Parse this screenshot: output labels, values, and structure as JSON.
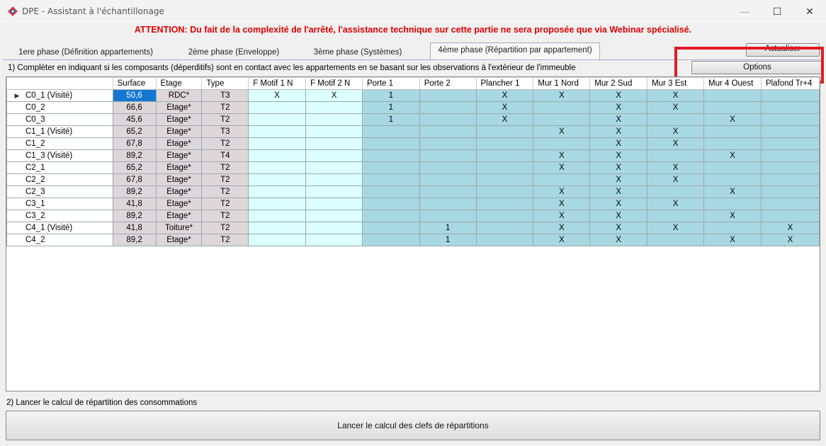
{
  "window": {
    "title": "DPE - Assistant à l'échantillonage",
    "min_glyph": "—",
    "max_glyph": "☐",
    "close_glyph": "✕",
    "icon": "app-logo-icon"
  },
  "attention": "ATTENTION: Du fait de la complexité de l'arrêté, l'assistance technique sur cette partie ne sera proposée que via Webinar spécialisé.",
  "tabs": [
    {
      "label": "1ere phase (Définition appartements)",
      "active": false
    },
    {
      "label": "2ème phase (Enveloppe)",
      "active": false
    },
    {
      "label": "3ème phase (Systèmes)",
      "active": false
    },
    {
      "label": "4ème phase (Répartition par appartement)",
      "active": true
    }
  ],
  "buttons": {
    "actualiser": "Actualiser",
    "options": "Options",
    "calc": "Lancer le calcul des clefs de répartitions"
  },
  "instructions": {
    "step1": "1) Compléter en indiquant si les composants (déperditifs) sont en contact avec les appartements en se basant sur les observations à l'extérieur de l'immeuble",
    "step2": "2) Lancer le calcul de répartition des consommations"
  },
  "grid": {
    "columns": [
      "Surface",
      "Etage",
      "Type",
      "F Motif 1 N",
      "F Motif 2 N",
      "Porte  1",
      "Porte  2",
      "Plancher  1",
      "Mur  1 Nord",
      "Mur  2 Sud",
      "Mur  3 Est",
      "Mur  4 Ouest",
      "Plafond Tr+4"
    ],
    "rows": [
      {
        "name": "C0_1 (Visité)",
        "cells": [
          "50,6",
          "RDC*",
          "T3",
          "X",
          "X",
          "1",
          "",
          "X",
          "X",
          "X",
          "X",
          "",
          ""
        ]
      },
      {
        "name": "C0_2",
        "cells": [
          "66,6",
          "Etage*",
          "T2",
          "",
          "",
          "1",
          "",
          "X",
          "",
          "X",
          "X",
          "",
          ""
        ]
      },
      {
        "name": "C0_3",
        "cells": [
          "45,6",
          "Etage*",
          "T2",
          "",
          "",
          "1",
          "",
          "X",
          "",
          "X",
          "",
          "X",
          ""
        ]
      },
      {
        "name": "C1_1 (Visité)",
        "cells": [
          "65,2",
          "Etage*",
          "T3",
          "",
          "",
          "",
          "",
          "",
          "X",
          "X",
          "X",
          "",
          ""
        ]
      },
      {
        "name": "C1_2",
        "cells": [
          "67,8",
          "Etage*",
          "T2",
          "",
          "",
          "",
          "",
          "",
          "",
          "X",
          "X",
          "",
          ""
        ]
      },
      {
        "name": "C1_3 (Visité)",
        "cells": [
          "89,2",
          "Etage*",
          "T4",
          "",
          "",
          "",
          "",
          "",
          "X",
          "X",
          "",
          "X",
          ""
        ]
      },
      {
        "name": "C2_1",
        "cells": [
          "65,2",
          "Etage*",
          "T2",
          "",
          "",
          "",
          "",
          "",
          "X",
          "X",
          "X",
          "",
          ""
        ]
      },
      {
        "name": "C2_2",
        "cells": [
          "67,8",
          "Etage*",
          "T2",
          "",
          "",
          "",
          "",
          "",
          "",
          "X",
          "X",
          "",
          ""
        ]
      },
      {
        "name": "C2_3",
        "cells": [
          "89,2",
          "Etage*",
          "T2",
          "",
          "",
          "",
          "",
          "",
          "X",
          "X",
          "",
          "X",
          ""
        ]
      },
      {
        "name": "C3_1",
        "cells": [
          "41,8",
          "Etage*",
          "T2",
          "",
          "",
          "",
          "",
          "",
          "X",
          "X",
          "X",
          "",
          ""
        ]
      },
      {
        "name": "C3_2",
        "cells": [
          "89,2",
          "Etage*",
          "T2",
          "",
          "",
          "",
          "",
          "",
          "X",
          "X",
          "",
          "X",
          ""
        ]
      },
      {
        "name": "C4_1 (Visité)",
        "cells": [
          "41,8",
          "Toiture*",
          "T2",
          "",
          "",
          "",
          "1",
          "",
          "X",
          "X",
          "X",
          "",
          "X"
        ]
      },
      {
        "name": "C4_2",
        "cells": [
          "89,2",
          "Etage*",
          "T2",
          "",
          "",
          "",
          "1",
          "",
          "X",
          "X",
          "",
          "X",
          "X"
        ]
      }
    ]
  }
}
